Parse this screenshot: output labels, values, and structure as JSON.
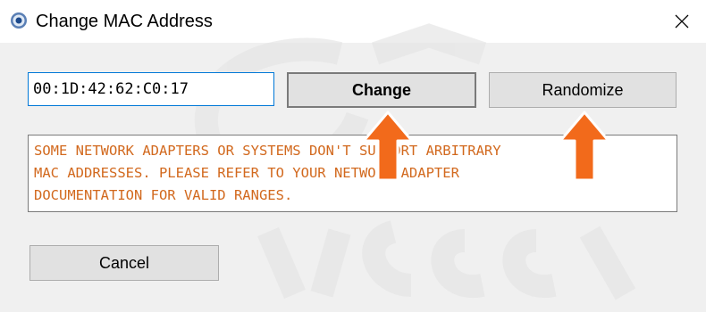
{
  "window": {
    "title": "Change MAC Address",
    "icon": "network-adapter-icon",
    "close_icon": "close-icon"
  },
  "form": {
    "mac_value": "00:1D:42:62:C0:17",
    "change_label": "Change",
    "randomize_label": "Randomize",
    "cancel_label": "Cancel",
    "message": "SOME NETWORK ADAPTERS OR SYSTEMS DON'T SUPPORT ARBITRARY\nMAC ADDRESSES. PLEASE REFER TO YOUR NETWORK ADAPTER\nDOCUMENTATION FOR VALID RANGES."
  },
  "annotations": {
    "arrow_color": "#f26a1b",
    "arrow_targets": [
      "Change",
      "Randomize"
    ]
  },
  "colors": {
    "message_text": "#d2691e",
    "focus_border": "#0078d7"
  }
}
